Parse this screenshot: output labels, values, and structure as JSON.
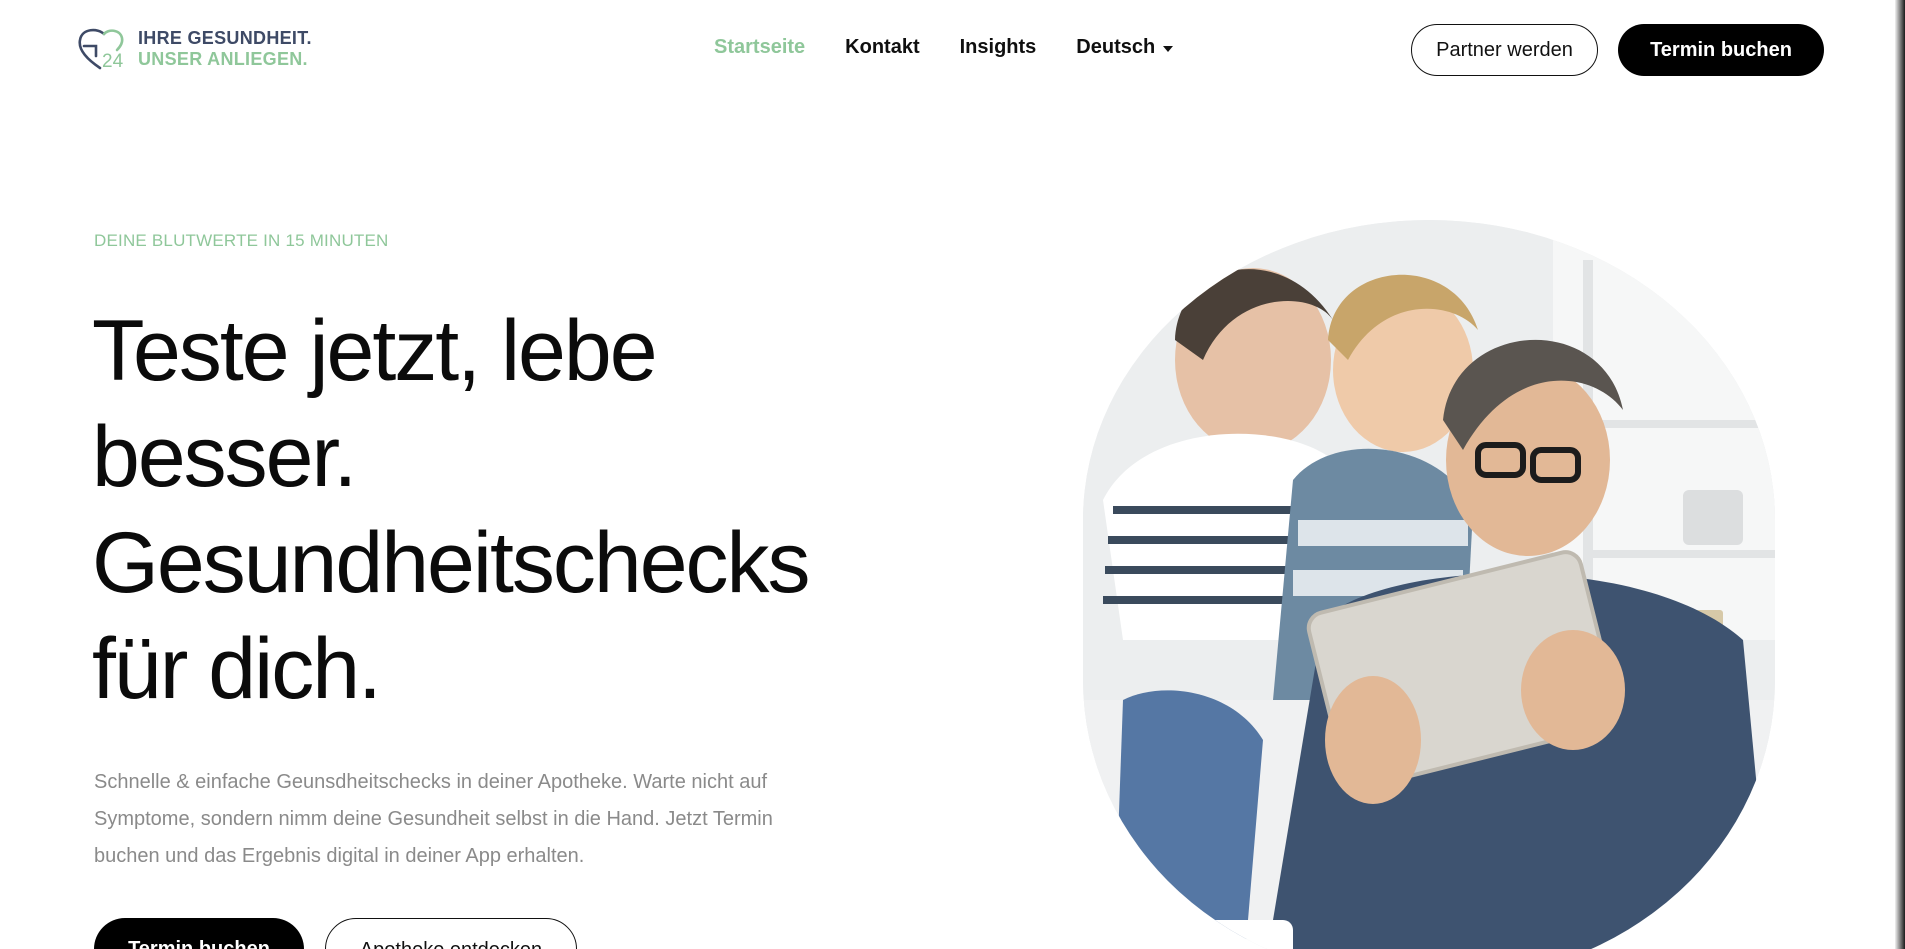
{
  "header": {
    "logo": {
      "mark_text": "24",
      "line1": "IHRE GESUNDHEIT.",
      "line2": "UNSER ANLIEGEN."
    },
    "nav": [
      {
        "label": "Startseite",
        "active": true
      },
      {
        "label": "Kontakt",
        "active": false
      },
      {
        "label": "Insights",
        "active": false
      },
      {
        "label": "Deutsch",
        "active": false,
        "dropdown": true
      }
    ],
    "partner_button": "Partner werden",
    "book_button": "Termin buchen"
  },
  "hero": {
    "eyebrow": "DEINE BLUTWERTE IN 15 MINUTEN",
    "headline": "Teste jetzt, lebe besser. Gesundheitschecks für dich.",
    "lead": "Schnelle & einfache Geunsdheitschecks in deiner Apotheke. Warte nicht auf Symptome, sondern nimm deine Gesundheit selbst in die Hand. Jetzt Termin buchen und das Ergebnis digital in deiner App erhalten.",
    "cta_primary": "Termin buchen",
    "cta_secondary": "Apotheke entdecken"
  },
  "colors": {
    "accent_green": "#8fc79a",
    "logo_navy": "#3e4a66",
    "text_dark": "#0b0b0b",
    "text_muted": "#8a8a8a"
  },
  "icons": [
    "heart-g-logo-icon",
    "chevron-down-icon"
  ]
}
